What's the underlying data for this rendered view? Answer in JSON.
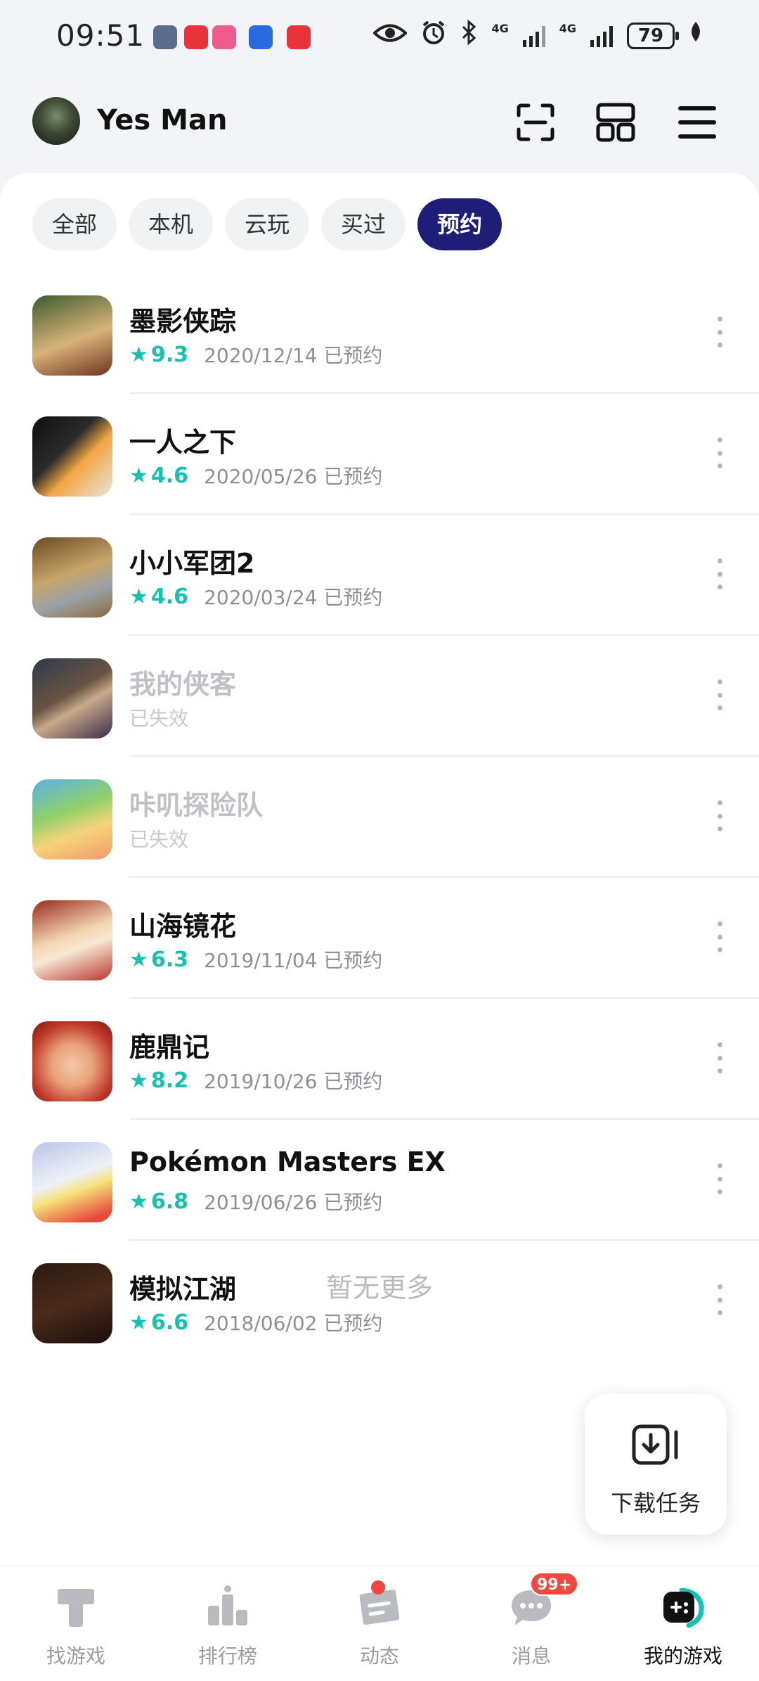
{
  "status_bar": {
    "time": "09:51",
    "network_1": "4G",
    "network_2": "4G",
    "battery": "79"
  },
  "header": {
    "username": "Yes Man"
  },
  "tabs": [
    {
      "label": "全部"
    },
    {
      "label": "本机"
    },
    {
      "label": "云玩"
    },
    {
      "label": "买过"
    },
    {
      "label": "预约"
    }
  ],
  "active_tab": "预约",
  "games": [
    {
      "title": "墨影侠踪",
      "rating": "9.3",
      "date_text": "2020/12/14 已预约",
      "valid": true
    },
    {
      "title": "一人之下",
      "rating": "4.6",
      "date_text": "2020/05/26 已预约",
      "valid": true
    },
    {
      "title": "小小军团2",
      "rating": "4.6",
      "date_text": "2020/03/24 已预约",
      "valid": true
    },
    {
      "title": "我的侠客",
      "rating": "",
      "date_text": "已失效",
      "valid": false
    },
    {
      "title": "咔叽探险队",
      "rating": "",
      "date_text": "已失效",
      "valid": false
    },
    {
      "title": "山海镜花",
      "rating": "6.3",
      "date_text": "2019/11/04 已预约",
      "valid": true
    },
    {
      "title": "鹿鼎记",
      "rating": "8.2",
      "date_text": "2019/10/26 已预约",
      "valid": true
    },
    {
      "title": "Pokémon Masters EX",
      "rating": "6.8",
      "date_text": "2019/06/26 已预约",
      "valid": true
    },
    {
      "title": "模拟江湖",
      "rating": "6.6",
      "date_text": "2018/06/02 已预约",
      "valid": true
    }
  ],
  "footer_note": "暂无更多",
  "download_float": {
    "label": "下载任务"
  },
  "bottom_nav": [
    {
      "label": "找游戏",
      "icon": "find-game-icon"
    },
    {
      "label": "排行榜",
      "icon": "ranking-icon"
    },
    {
      "label": "动态",
      "icon": "feed-icon"
    },
    {
      "label": "消息",
      "icon": "message-icon",
      "badge": "99+"
    },
    {
      "label": "我的游戏",
      "icon": "my-games-icon"
    }
  ],
  "colors": {
    "accent": "#1e1e78",
    "rating": "#17c1b0",
    "badge": "#f0483e"
  }
}
